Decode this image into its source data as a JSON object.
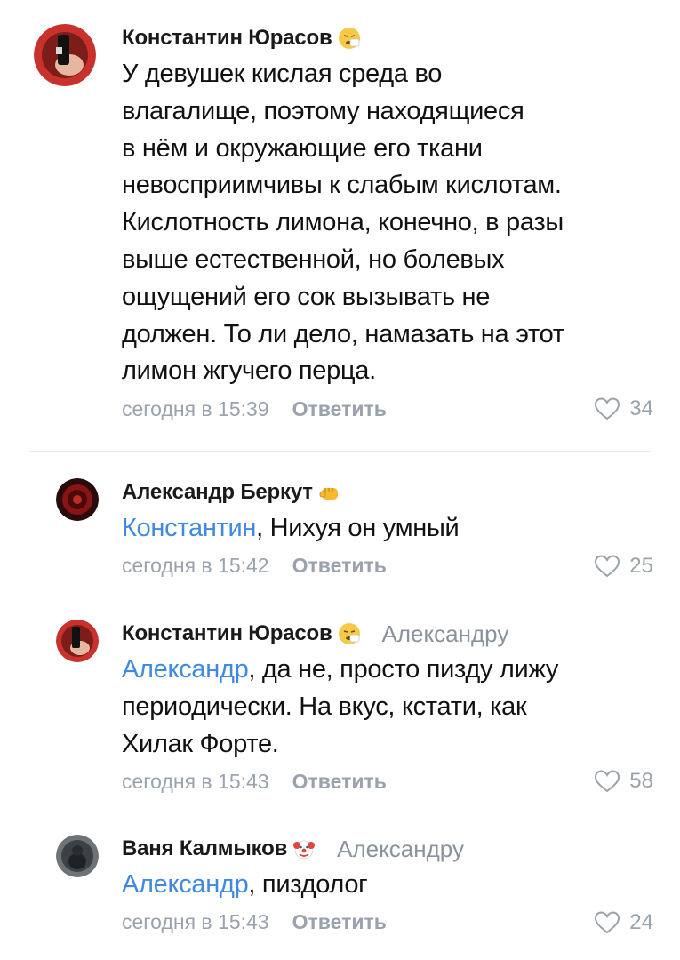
{
  "comments": [
    {
      "author": "Константин Юрасов",
      "author_emoji": "sneezing-face-emoji",
      "text_lines": [
        "У девушек кислая среда во",
        "влагалище, поэтому находящиеся",
        "в нём и окружающие его ткани",
        "невосприимчивы к слабым кислотам.",
        "Кислотность лимона, конечно, в разы",
        "выше естественной, но болевых",
        "ощущений его сок вызывать не",
        "должен. То ли дело, намазать на этот",
        "лимон жгучего перца."
      ],
      "time": "сегодня в 15:39",
      "reply_label": "Ответить",
      "likes": "34"
    },
    {
      "author": "Александр Беркут",
      "author_emoji": "fist-emoji",
      "mention": "Константин",
      "text": ", Нихуя он умный",
      "time": "сегодня в 15:42",
      "reply_label": "Ответить",
      "likes": "25"
    },
    {
      "author": "Константин Юрасов",
      "author_emoji": "sneezing-face-emoji",
      "reply_to": "Александру",
      "mention": "Александр",
      "text_line1": ", да не, просто пизду лижу",
      "text_lines_rest": [
        "периодически. На вкус, кстати, как",
        "Хилак Форте."
      ],
      "time": "сегодня в 15:43",
      "reply_label": "Ответить",
      "likes": "58"
    },
    {
      "author": "Ваня Калмыков",
      "author_emoji": "clown-face-emoji",
      "reply_to": "Александру",
      "mention": "Александр",
      "text": ", пиздолог",
      "time": "сегодня в 15:43",
      "reply_label": "Ответить",
      "likes": "24"
    }
  ],
  "colors": {
    "link": "#3f8ae0",
    "secondary": "#99a2ad",
    "divider": "#e3e4e8"
  }
}
